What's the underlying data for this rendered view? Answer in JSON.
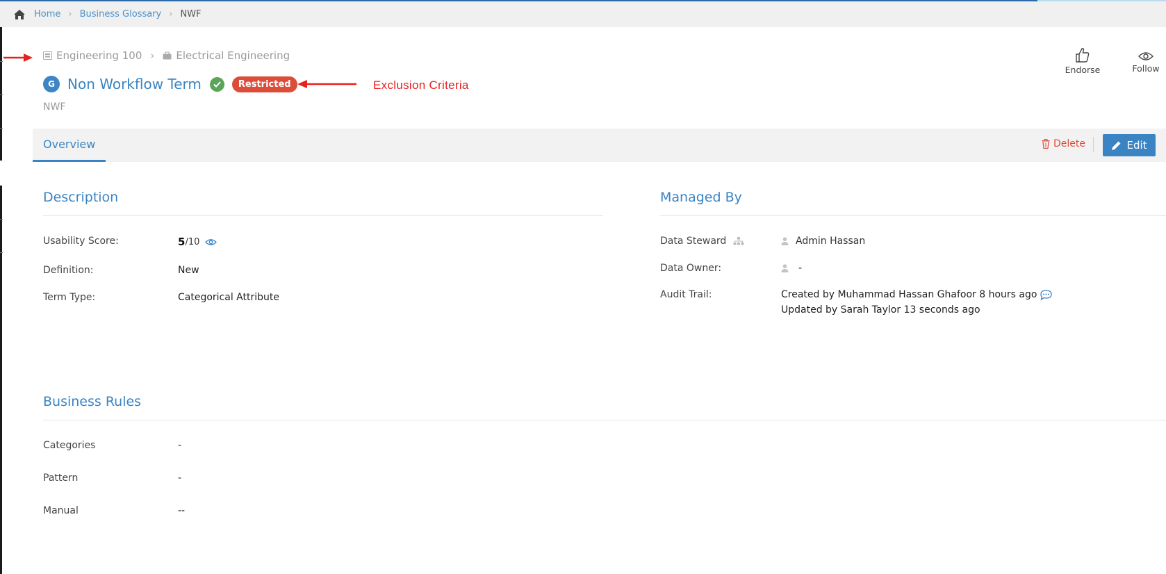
{
  "breadcrumb": {
    "home": "Home",
    "glossary": "Business Glossary",
    "current": "NWF"
  },
  "parent_path": {
    "first": "Engineering 100",
    "second": "Electrical Engineering"
  },
  "term": {
    "badge_letter": "G",
    "title": "Non Workflow Term",
    "status_label": "Restricted",
    "abbreviation": "NWF"
  },
  "annotation": {
    "label": "Exclusion Criteria",
    "color": "#e8201e"
  },
  "actions": {
    "endorse": "Endorse",
    "follow": "Follow",
    "delete": "Delete",
    "edit": "Edit"
  },
  "tabs": {
    "overview": "Overview"
  },
  "description": {
    "heading": "Description",
    "usability_label": "Usability Score:",
    "usability_score": "5",
    "usability_max": "/10",
    "definition_label": "Definition:",
    "definition_value": "New",
    "term_type_label": "Term Type:",
    "term_type_value": "Categorical Attribute"
  },
  "managed_by": {
    "heading": "Managed By",
    "steward_label": "Data Steward",
    "steward_value": "Admin Hassan",
    "owner_label": "Data Owner:",
    "owner_value": "-",
    "audit_label": "Audit Trail:",
    "audit_created": "Created by Muhammad Hassan Ghafoor 8 hours ago",
    "audit_updated": "Updated by Sarah Taylor 13 seconds ago"
  },
  "business_rules": {
    "heading": "Business Rules",
    "categories_label": "Categories",
    "categories_value": "-",
    "pattern_label": "Pattern",
    "pattern_value": "-",
    "manual_label": "Manual",
    "manual_value": "--"
  },
  "colors": {
    "accent": "#3a84c3",
    "danger": "#dd4b39",
    "success": "#5aa55a"
  }
}
